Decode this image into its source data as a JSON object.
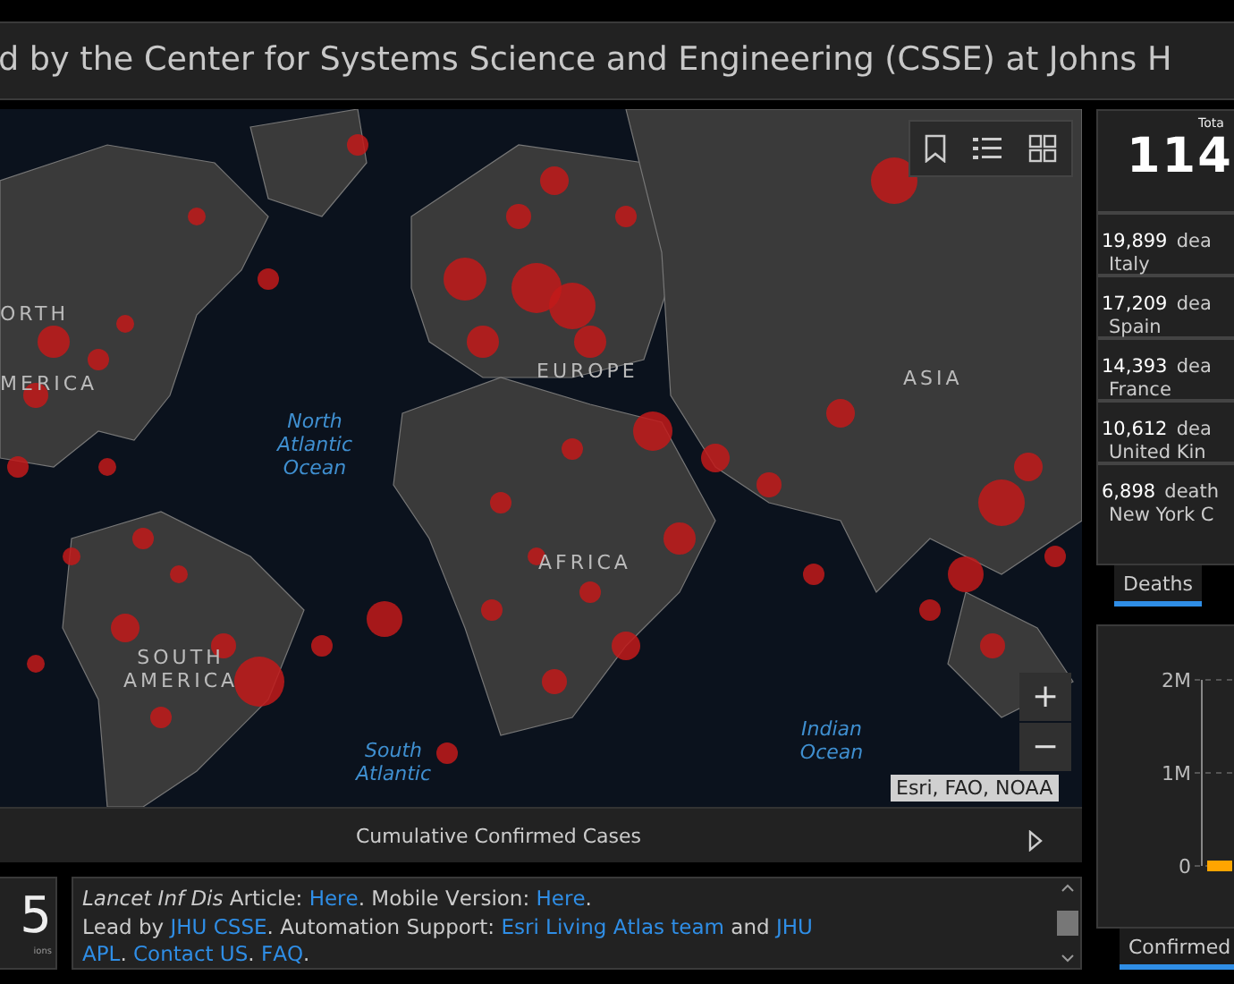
{
  "title": "d by the Center for Systems Science and Engineering (CSSE) at Johns H",
  "map": {
    "labels": [
      {
        "text": "ORTH",
        "kind": "region"
      },
      {
        "text": "MERICA",
        "kind": "region"
      },
      {
        "text": "EUROPE",
        "kind": "region"
      },
      {
        "text": "ASIA",
        "kind": "region"
      },
      {
        "text": "AFRICA",
        "kind": "region"
      },
      {
        "text": "SOUTH AMERICA",
        "kind": "region"
      },
      {
        "text": "North Atlantic Ocean",
        "kind": "ocean"
      },
      {
        "text": "Indian Ocean",
        "kind": "ocean"
      },
      {
        "text": "South Atlantic",
        "kind": "ocean"
      }
    ],
    "attribution": "Esri, FAO, NOAA",
    "zoom_in": "+",
    "zoom_out": "−",
    "caption": "Cumulative Confirmed Cases"
  },
  "stats": {
    "total_label": "Tota",
    "total": "114",
    "items": [
      {
        "count": "19,899",
        "unit": "dea",
        "place": "Italy"
      },
      {
        "count": "17,209",
        "unit": "dea",
        "place": "Spain"
      },
      {
        "count": "14,393",
        "unit": "dea",
        "place": "France"
      },
      {
        "count": "10,612",
        "unit": "dea",
        "place": "United Kin"
      },
      {
        "count": "6,898",
        "unit": "death",
        "place": "New York C"
      }
    ],
    "tabs": [
      {
        "label": "Deaths",
        "selected": true
      }
    ]
  },
  "count_card": {
    "value": "5",
    "caption": "ions"
  },
  "info": {
    "lines": [
      [
        {
          "text": "*Lancet Inf Dis* Article: ",
          "link": false
        },
        {
          "text": "Here",
          "link": true,
          "after": ". Mobile Version: "
        },
        {
          "text": "Here",
          "link": true,
          "after": "."
        }
      ],
      [
        {
          "text": "Lead by ",
          "link": false
        },
        {
          "text": "JHU CSSE",
          "link": true,
          "after": ". Automation Support: "
        },
        {
          "text": "Esri Living Atlas team",
          "link": true,
          "after": " and "
        },
        {
          "text": "JHU",
          "link": true
        }
      ],
      [
        {
          "text": "APL",
          "link": true,
          "after": ". "
        },
        {
          "text": "Contact US",
          "link": true,
          "after": ". "
        },
        {
          "text": "FAQ",
          "link": true,
          "after": "."
        }
      ]
    ]
  },
  "chart_panel": {
    "axis_labels": [
      "2M",
      "1M",
      "0"
    ],
    "tabs": [
      {
        "label": "Confirmed",
        "selected": true
      }
    ]
  }
}
